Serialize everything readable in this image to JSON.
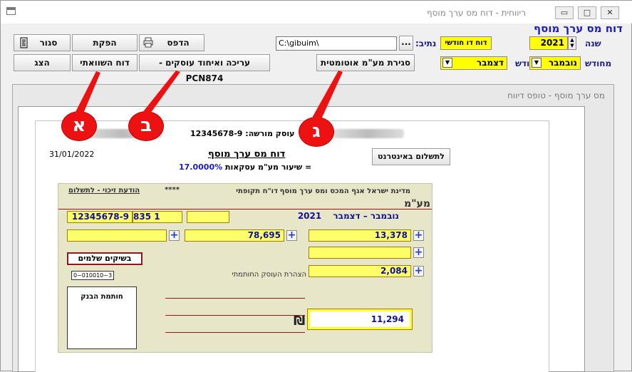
{
  "window": {
    "title": "ריווחית - דוח מס ערך מוסף",
    "minimize_glyph": "▭",
    "maximize_glyph": "□",
    "close_glyph": "✕"
  },
  "header": {
    "main_title": "דוח מס ערך מוסף",
    "year_label": "שנה",
    "year_value": "2021",
    "report_type": "דוח דו חודשי",
    "path_label": "נתיב:",
    "path_value": "C:\\gibuim\\",
    "browse_label": "...",
    "from_month_label": "מחודש",
    "from_month_value": "נובמבר",
    "to_month_label": "עד חודש",
    "to_month_value": "דצמבר"
  },
  "toolbar": {
    "close_label": "סגור",
    "pcn_export_label": "הפקת PCN874",
    "print_label": "הדפס",
    "show_label": "הצג",
    "compare_label": "דוח השוואתי",
    "pcn_edit_label": "עריכה ואיחוד עוסקים - PCN874",
    "auto_close_label": "סגירת מע\"מ אוטומטית"
  },
  "frame": {
    "title": "מס ערך מוסף - טופס דיווח"
  },
  "callouts": {
    "a": "א",
    "b": "ב",
    "g": "ג"
  },
  "report": {
    "dealer_label": "עוסק מורשה:",
    "dealer_number": "12345678-9",
    "date": "31/01/2022",
    "title": "דוח מס ערך מוסף",
    "rate_label": "שיעור מע\"מ עסקאות =",
    "rate_value": "17.0000%",
    "pay_online": "לתשלום באינטרנט"
  },
  "form": {
    "header_left": "מדינת ישראל אגף המכס ומס ערך מוסף",
    "header_mid": "דו\"ח תקופתי",
    "header_stars": "****",
    "header_right": "הודעת זיכוי - לתשלום",
    "id_field": "12345678-9",
    "code_field": "835 1",
    "month_from": "נובמבר",
    "month_to": "דצמבר",
    "year": "2021",
    "vat_on_sales": "13,378",
    "taxable_sales": "78,695",
    "vat_other_inputs": "2,084",
    "total_to_pay": "11,294",
    "cash_label": "בשיקים שלמים",
    "bank_stamp": "חותמת הבנק",
    "bank_code": "0~010010~3",
    "declaration": "הצהרת העוסק החותמתי",
    "mam_logo": "מע\"מ",
    "shekel_symbol": "₪"
  }
}
